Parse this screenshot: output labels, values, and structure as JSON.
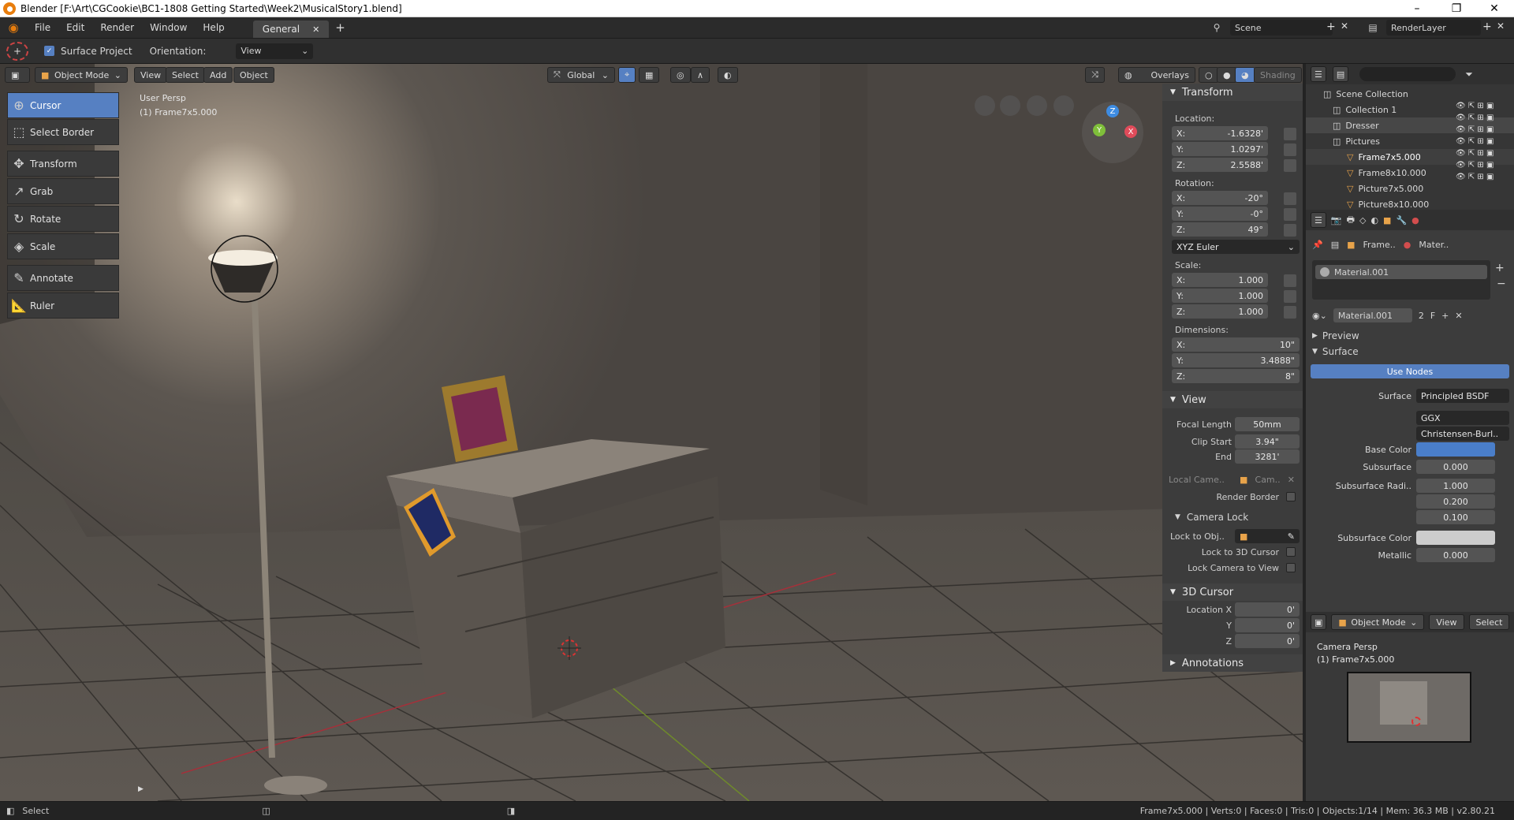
{
  "window": {
    "title": "Blender [F:\\Art\\CGCookie\\BC1-1808 Getting Started\\Week2\\MusicalStory1.blend]",
    "controls": [
      "–",
      "❐",
      "✕"
    ]
  },
  "menubar": {
    "items": [
      "File",
      "Edit",
      "Render",
      "Window",
      "Help"
    ],
    "workspace_tab": "General",
    "scene": "Scene",
    "render_layer": "RenderLayer"
  },
  "toolsettings": {
    "surface_project": "Surface Project",
    "surface_project_checked": true,
    "orientation_label": "Orientation:",
    "orientation_value": "View"
  },
  "viewport_header": {
    "mode": "Object Mode",
    "menus": [
      "View",
      "Select",
      "Add",
      "Object"
    ],
    "transform_orientation": "Global",
    "overlays": "Overlays",
    "shading": "Shading"
  },
  "viewport": {
    "view_name": "User Persp",
    "object_info": "(1) Frame7x5.000",
    "gizmo_axes": [
      "Z",
      "X",
      "Y"
    ]
  },
  "tools": [
    {
      "label": "Cursor",
      "icon": "cursor-icon",
      "active": true
    },
    {
      "label": "Select Border",
      "icon": "select-border-icon",
      "active": false
    },
    {
      "label": "Transform",
      "icon": "transform-icon",
      "active": false
    },
    {
      "label": "Grab",
      "icon": "grab-icon",
      "active": false
    },
    {
      "label": "Rotate",
      "icon": "rotate-icon",
      "active": false
    },
    {
      "label": "Scale",
      "icon": "scale-icon",
      "active": false
    },
    {
      "label": "Annotate",
      "icon": "annotate-icon",
      "active": false
    },
    {
      "label": "Ruler",
      "icon": "ruler-icon",
      "active": false
    }
  ],
  "npanel": {
    "transform": {
      "title": "Transform",
      "location_label": "Location:",
      "location": {
        "X": "-1.6328'",
        "Y": "1.0297'",
        "Z": "2.5588'"
      },
      "rotation_label": "Rotation:",
      "rotation": {
        "X": "-20°",
        "Y": "-0°",
        "Z": "49°"
      },
      "rotation_mode": "XYZ Euler",
      "scale_label": "Scale:",
      "scale": {
        "X": "1.000",
        "Y": "1.000",
        "Z": "1.000"
      },
      "dimensions_label": "Dimensions:",
      "dimensions": {
        "X": "10\"",
        "Y": "3.4888\"",
        "Z": "8\""
      }
    },
    "view": {
      "title": "View",
      "focal_length_label": "Focal Length",
      "focal_length": "50mm",
      "clip_start_label": "Clip Start",
      "clip_start": "3.94\"",
      "clip_end_label": "End",
      "clip_end": "3281'",
      "local_camera_label": "Local Came..",
      "local_camera": "Cam..",
      "render_border": "Render Border",
      "camera_lock_title": "Camera Lock",
      "lock_to_obj": "Lock to Obj..",
      "lock_to_cursor": "Lock to 3D Cursor",
      "lock_camera_to_view": "Lock Camera to View"
    },
    "cursor": {
      "title": "3D Cursor",
      "loc_x_label": "Location X",
      "loc_y_label": "Y",
      "loc_z_label": "Z",
      "x": "0'",
      "y": "0'",
      "z": "0'"
    },
    "annotations": {
      "title": "Annotations"
    }
  },
  "outliner": {
    "rows": [
      {
        "label": "Scene Collection",
        "indent": 0
      },
      {
        "label": "Collection 1",
        "indent": 1
      },
      {
        "label": "Dresser",
        "indent": 1
      },
      {
        "label": "Pictures",
        "indent": 1
      },
      {
        "label": "Frame7x5.000",
        "indent": 2
      },
      {
        "label": "Frame8x10.000",
        "indent": 2
      },
      {
        "label": "Picture7x5.000",
        "indent": 2
      },
      {
        "label": "Picture8x10.000",
        "indent": 2
      }
    ]
  },
  "properties": {
    "breadcrumb_object": "Frame..",
    "breadcrumb_material": "Mater..",
    "slot_name": "Material.001",
    "material_name": "Material.001",
    "material_users": "2",
    "material_fake": "F",
    "preview": "Preview",
    "surface_title": "Surface",
    "use_nodes": "Use Nodes",
    "surface_label": "Surface",
    "surface_value": "Principled BSDF",
    "distribution": "GGX",
    "subsurface_method": "Christensen-Burl..",
    "base_color_label": "Base Color",
    "base_color": "#4a7ec9",
    "subsurface_label": "Subsurface",
    "subsurface": "0.000",
    "subsurface_radius_label": "Subsurface Radi..",
    "subsurface_radius": [
      "1.000",
      "0.200",
      "0.100"
    ],
    "subsurface_color_label": "Subsurface Color",
    "subsurface_color": "#cccccc",
    "metallic_label": "Metallic",
    "metallic": "0.000"
  },
  "camview": {
    "mode": "Object Mode",
    "menus": [
      "View",
      "Select"
    ],
    "view_name": "Camera Persp",
    "object_info": "(1) Frame7x5.000"
  },
  "statusbar": {
    "left": "Select",
    "stats": "Frame7x5.000 | Verts:0 | Faces:0 | Tris:0 | Objects:1/14 | Mem: 36.3 MB | v2.80.21"
  }
}
